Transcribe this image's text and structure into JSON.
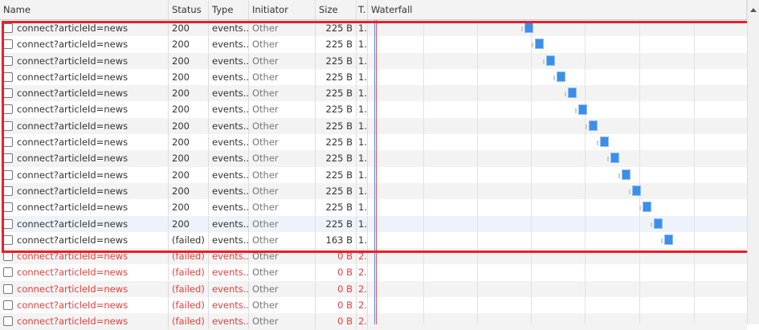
{
  "columns": {
    "name": "Name",
    "status": "Status",
    "type": "Type",
    "initiator": "Initiator",
    "size": "Size",
    "time": "T.",
    "waterfall": "Waterfall"
  },
  "rows": [
    {
      "name": "connect?articleId=news",
      "status": "200",
      "type": "events...",
      "initiator": "Other",
      "size": "225 B",
      "time": "1.",
      "failed": false
    },
    {
      "name": "connect?articleId=news",
      "status": "200",
      "type": "events...",
      "initiator": "Other",
      "size": "225 B",
      "time": "1.",
      "failed": false
    },
    {
      "name": "connect?articleId=news",
      "status": "200",
      "type": "events...",
      "initiator": "Other",
      "size": "225 B",
      "time": "1.",
      "failed": false
    },
    {
      "name": "connect?articleId=news",
      "status": "200",
      "type": "events...",
      "initiator": "Other",
      "size": "225 B",
      "time": "1.",
      "failed": false
    },
    {
      "name": "connect?articleId=news",
      "status": "200",
      "type": "events...",
      "initiator": "Other",
      "size": "225 B",
      "time": "1.",
      "failed": false
    },
    {
      "name": "connect?articleId=news",
      "status": "200",
      "type": "events...",
      "initiator": "Other",
      "size": "225 B",
      "time": "1.",
      "failed": false
    },
    {
      "name": "connect?articleId=news",
      "status": "200",
      "type": "events...",
      "initiator": "Other",
      "size": "225 B",
      "time": "1.",
      "failed": false
    },
    {
      "name": "connect?articleId=news",
      "status": "200",
      "type": "events...",
      "initiator": "Other",
      "size": "225 B",
      "time": "1.",
      "failed": false
    },
    {
      "name": "connect?articleId=news",
      "status": "200",
      "type": "events...",
      "initiator": "Other",
      "size": "225 B",
      "time": "1.",
      "failed": false
    },
    {
      "name": "connect?articleId=news",
      "status": "200",
      "type": "events...",
      "initiator": "Other",
      "size": "225 B",
      "time": "1.",
      "failed": false
    },
    {
      "name": "connect?articleId=news",
      "status": "200",
      "type": "events...",
      "initiator": "Other",
      "size": "225 B",
      "time": "1.",
      "failed": false
    },
    {
      "name": "connect?articleId=news",
      "status": "200",
      "type": "events...",
      "initiator": "Other",
      "size": "225 B",
      "time": "1.",
      "failed": false
    },
    {
      "name": "connect?articleId=news",
      "status": "200",
      "type": "events...",
      "initiator": "Other",
      "size": "225 B",
      "time": "1.",
      "failed": false
    },
    {
      "name": "connect?articleId=news",
      "status": "(failed)",
      "type": "events...",
      "initiator": "Other",
      "size": "163 B",
      "time": "1.",
      "failed": false
    },
    {
      "name": "connect?articleId=news",
      "status": "(failed)",
      "type": "events...",
      "initiator": "Other",
      "size": "0 B",
      "time": "2.",
      "failed": true
    },
    {
      "name": "connect?articleId=news",
      "status": "(failed)",
      "type": "events...",
      "initiator": "Other",
      "size": "0 B",
      "time": "2.",
      "failed": true
    },
    {
      "name": "connect?articleId=news",
      "status": "(failed)",
      "type": "events...",
      "initiator": "Other",
      "size": "0 B",
      "time": "2.",
      "failed": true
    },
    {
      "name": "connect?articleId=news",
      "status": "(failed)",
      "type": "events...",
      "initiator": "Other",
      "size": "0 B",
      "time": "2.",
      "failed": true
    },
    {
      "name": "connect?articleId=news",
      "status": "(failed)",
      "type": "events...",
      "initiator": "Other",
      "size": "0 B",
      "time": "2.",
      "failed": true
    }
  ],
  "colors": {
    "highlight_box": "#e8202a",
    "bar": "#3d8ee8",
    "error_text": "#e0403a"
  }
}
